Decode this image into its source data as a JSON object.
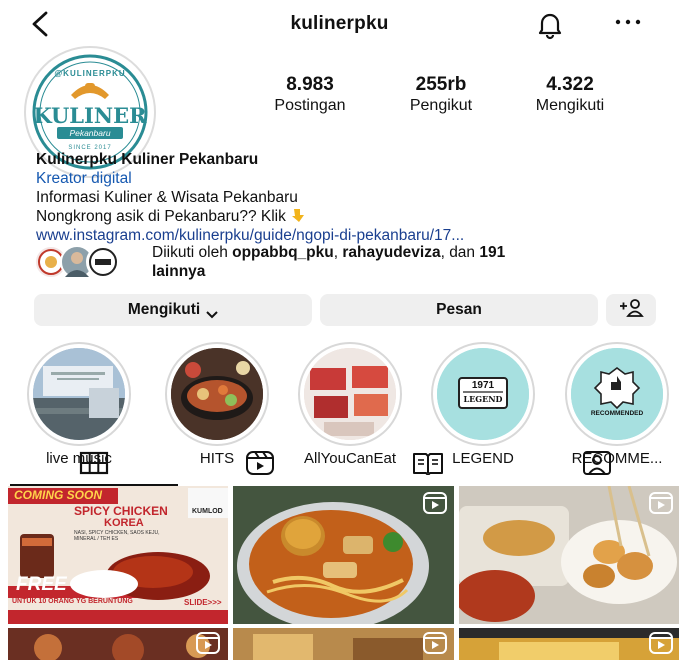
{
  "header": {
    "username": "kulinerpku",
    "back_icon": "back-chevron-icon",
    "bell_icon": "bell-icon",
    "more_icon": "more-dots-icon"
  },
  "avatar": {
    "top_text": "@KULINERPKU",
    "main_text": "KULINER",
    "sub_text": "Pekanbaru",
    "since_text": "SINCE 2017",
    "colors": {
      "teal": "#2a8c94",
      "orange": "#e2982c",
      "navy": "#1f4f7a"
    }
  },
  "stats": [
    {
      "value": "8.983",
      "label": "Postingan"
    },
    {
      "value": "255rb",
      "label": "Pengikut"
    },
    {
      "value": "4.322",
      "label": "Mengikuti"
    }
  ],
  "bio": {
    "name": "Kulinerpku Kuliner Pekanbaru",
    "category": "Kreator digital",
    "line1": "Informasi Kuliner & Wisata Pekanbaru",
    "line2": "Nongkrong asik di Pekanbaru?? Klik",
    "link": "www.instagram.com/kulinerpku/guide/ngopi-di-pekanbaru/17..."
  },
  "followed_by": {
    "prefix": "Diikuti oleh ",
    "user1": "oppabbq_pku",
    "sep": ", ",
    "user2": "rahayudeviza",
    "mid": ", dan ",
    "count": "191",
    "suffix": "lainnya"
  },
  "buttons": {
    "following": "Mengikuti",
    "message": "Pesan",
    "add_person_icon": "add-person-icon"
  },
  "highlights": [
    {
      "label": "live music"
    },
    {
      "label": "HITS"
    },
    {
      "label": "AllYouCanEat"
    },
    {
      "label": "LEGEND",
      "badge_year": "1971",
      "badge_text": "LEGEND"
    },
    {
      "label": "RECOMME...",
      "badge_text": "RECOMMENDED"
    }
  ],
  "tabs": [
    {
      "icon": "grid-icon",
      "active": true
    },
    {
      "icon": "reels-icon",
      "active": false
    },
    {
      "icon": "guide-icon",
      "active": false
    },
    {
      "icon": "tagged-icon",
      "active": false
    }
  ],
  "posts": {
    "post1": {
      "banner": "COMING SOON",
      "title1": "SPICY CHICKEN",
      "title2": "KOREA",
      "subtitle": "NASI, SPICY CHICKEN, SAOS KEJU, MINERAL / TEH ES",
      "brand": "KUMLOD",
      "free": "FREE",
      "free_sub": "UNTUK 10 ORANG YG BERUNTUNG",
      "slide": "SLIDE>>>"
    }
  }
}
